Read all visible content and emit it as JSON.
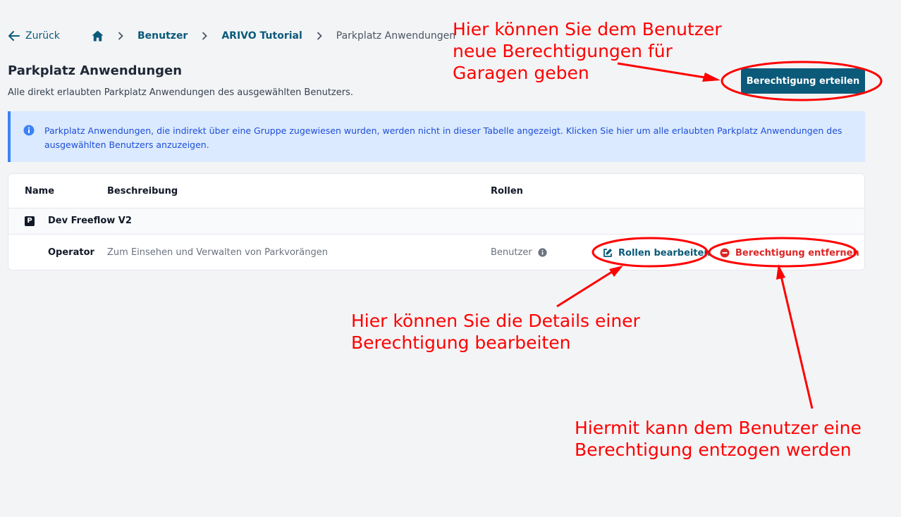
{
  "nav": {
    "back_label": "Zurück",
    "breadcrumbs": [
      {
        "label": "Benutzer"
      },
      {
        "label": "ARIVO Tutorial"
      },
      {
        "label": "Parkplatz Anwendungen"
      }
    ]
  },
  "page": {
    "title": "Parkplatz Anwendungen",
    "subtitle": "Alle direkt erlaubten Parkplatz Anwendungen des ausgewählten Benutzers.",
    "grant_button": "Berechtigung erteilen"
  },
  "info_banner": {
    "text": "Parkplatz Anwendungen, die indirekt über eine Gruppe zugewiesen wurden, werden nicht in dieser Tabelle angezeigt. Klicken Sie hier um alle erlaubten Parkplatz Anwendungen des ausgewählten Benutzers anzuzeigen."
  },
  "table": {
    "headers": {
      "name": "Name",
      "description": "Beschreibung",
      "roles": "Rollen"
    },
    "group": {
      "icon_letter": "P",
      "name": "Dev Freeflow V2"
    },
    "row": {
      "name": "Operator",
      "description": "Zum Einsehen und Verwalten von Parkvorängen",
      "role": "Benutzer",
      "edit_label": "Rollen bearbeiten",
      "remove_label": "Berechtigung entfernen"
    }
  },
  "annotations": {
    "grant_note": "Hier können Sie dem Benutzer\nneue Berechtigungen für\nGaragen geben",
    "edit_note": "Hier können Sie die Details einer\nBerechtigung bearbeiten",
    "remove_note": "Hiermit kann dem Benutzer eine\nBerechtigung entzogen werden"
  },
  "colors": {
    "primary": "#0b5a7a",
    "danger": "#dc2626",
    "info_bg": "#dbeafe",
    "info_text": "#1d4ed8",
    "annotation": "#ff0000"
  }
}
